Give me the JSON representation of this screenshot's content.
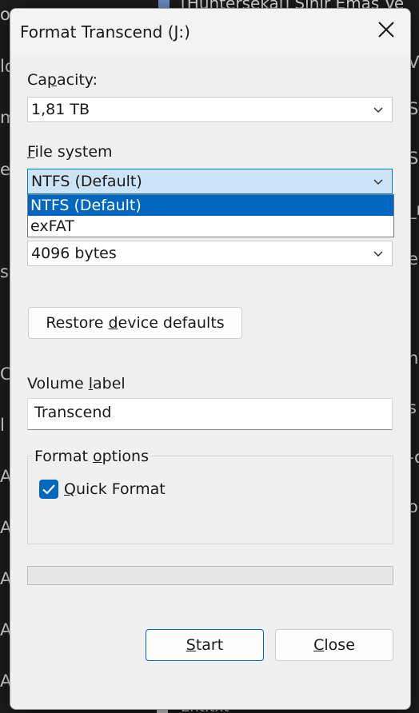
{
  "background": {
    "top_title": "[Huntersekai] Sihir Emas Ve",
    "left_fragments": [
      "o",
      "lo",
      "m",
      "e",
      "s",
      "C",
      "l",
      "A",
      "A",
      "A",
      "A",
      "A",
      "A"
    ],
    "right_fragments": [
      "V",
      "e",
      "S",
      "S",
      "_r",
      "e",
      "n",
      "s",
      "-o",
      "or"
    ],
    "bottom_file": "Ent.txt"
  },
  "dialog": {
    "title": "Format Transcend (J:)",
    "capacity": {
      "label_pre": "Ca",
      "label_ul": "p",
      "label_post": "acity:",
      "value": "1,81 TB"
    },
    "file_system": {
      "label_pre": "",
      "label_ul": "F",
      "label_post": "ile system",
      "value": "NTFS (Default)",
      "options": [
        "NTFS (Default)",
        "exFAT"
      ],
      "selected_index": 0
    },
    "allocation": {
      "value": "4096 bytes"
    },
    "restore_button": {
      "pre": "Restore ",
      "ul": "d",
      "post": "evice defaults"
    },
    "volume_label": {
      "label_pre": "Volume ",
      "label_ul": "l",
      "label_post": "abel",
      "value": "Transcend"
    },
    "format_options": {
      "legend_pre": "Format ",
      "legend_ul": "o",
      "legend_post": "ptions",
      "quick_format_pre": "",
      "quick_format_ul": "Q",
      "quick_format_post": "uick Format",
      "quick_format_checked": true
    },
    "progress": 0,
    "start_button": {
      "ul": "S",
      "post": "tart"
    },
    "close_button": {
      "ul": "C",
      "post": "lose"
    }
  },
  "colors": {
    "accent": "#0067c0",
    "dialog_bg": "#f0f0f0",
    "dropdown_open_bg": "#cce4f7"
  }
}
